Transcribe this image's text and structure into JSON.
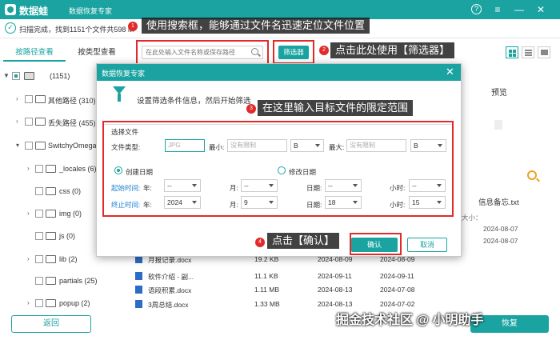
{
  "app": {
    "name": "数据蛙",
    "subtitle": "数据恢复专家"
  },
  "status": {
    "text": "扫描完成，找到1151个文件共598 M"
  },
  "tabs": [
    {
      "label": "按路径查看"
    },
    {
      "label": "按类型查看"
    }
  ],
  "tree": [
    {
      "label": "(1151)"
    },
    {
      "label": "其他路径 (310)"
    },
    {
      "label": "丢失路径 (455)"
    },
    {
      "label": "SwitchyOmega"
    },
    {
      "label": "_locales (6)"
    },
    {
      "label": "css (0)"
    },
    {
      "label": "img (0)"
    },
    {
      "label": "js (0)"
    },
    {
      "label": "lib (2)"
    },
    {
      "label": "partials (25)"
    },
    {
      "label": "popup (2)"
    }
  ],
  "search": {
    "placeholder": "在此处输入文件名称或保存路径"
  },
  "toolbar": {
    "filter_label": "筛选器"
  },
  "callouts": [
    {
      "num": "1",
      "text": "使用搜索框，能够通过文件名迅速定位文件位置"
    },
    {
      "num": "2",
      "text": "点击此处使用【筛选器】"
    },
    {
      "num": "3",
      "text": "在这里输入目标文件的限定范围"
    },
    {
      "num": "4",
      "text": "点击【确认】"
    }
  ],
  "preview": {
    "title": "预览",
    "file_name": "信息备忘.txt",
    "meta": [
      {
        "label": "大小：",
        "value": ""
      },
      {
        "label": "",
        "value": "2024-08-07"
      },
      {
        "label": "",
        "value": "2024-08-07"
      }
    ]
  },
  "files": [
    {
      "name": "月报记录.docx",
      "size": "19.2 KB",
      "created": "2024-08-09",
      "modified": "2024-08-09"
    },
    {
      "name": "软件介绍 - 副...",
      "size": "11.1 KB",
      "created": "2024-09-11",
      "modified": "2024-09-11"
    },
    {
      "name": "语段积累.docx",
      "size": "1.11 MB",
      "created": "2024-08-13",
      "modified": "2024-07-08"
    },
    {
      "name": "3周总结.docx",
      "size": "1.33 MB",
      "created": "2024-08-13",
      "modified": "2024-07-02"
    }
  ],
  "dialog": {
    "title": "数据恢复专家",
    "description": "设置筛选条件信息，然后开始筛选",
    "section_title": "选择文件",
    "file_type_label": "文件类型:",
    "file_type_placeholder": "JPG",
    "min_label": "最小:",
    "max_label": "最大:",
    "size_placeholder": "没有限制",
    "size_unit": "B",
    "radio_created": "创建日期",
    "radio_modified": "修改日期",
    "start_label": "起始时间:",
    "end_label": "终止时间:",
    "year_label": "年:",
    "month_label": "月:",
    "day_label": "日期:",
    "hour_label": "小时:",
    "start": {
      "year": "--",
      "month": "--",
      "day": "--",
      "hour": "--"
    },
    "end": {
      "year": "2024",
      "month": "9",
      "day": "18",
      "hour": "15"
    },
    "ok_label": "确认",
    "cancel_label": "取消"
  },
  "buttons": {
    "back": "返回",
    "recover": "恢复"
  },
  "watermark": "掘金技术社区 @ 小明助手",
  "colors": {
    "accent": "#1aa3a1",
    "highlight": "#e22a2a"
  }
}
